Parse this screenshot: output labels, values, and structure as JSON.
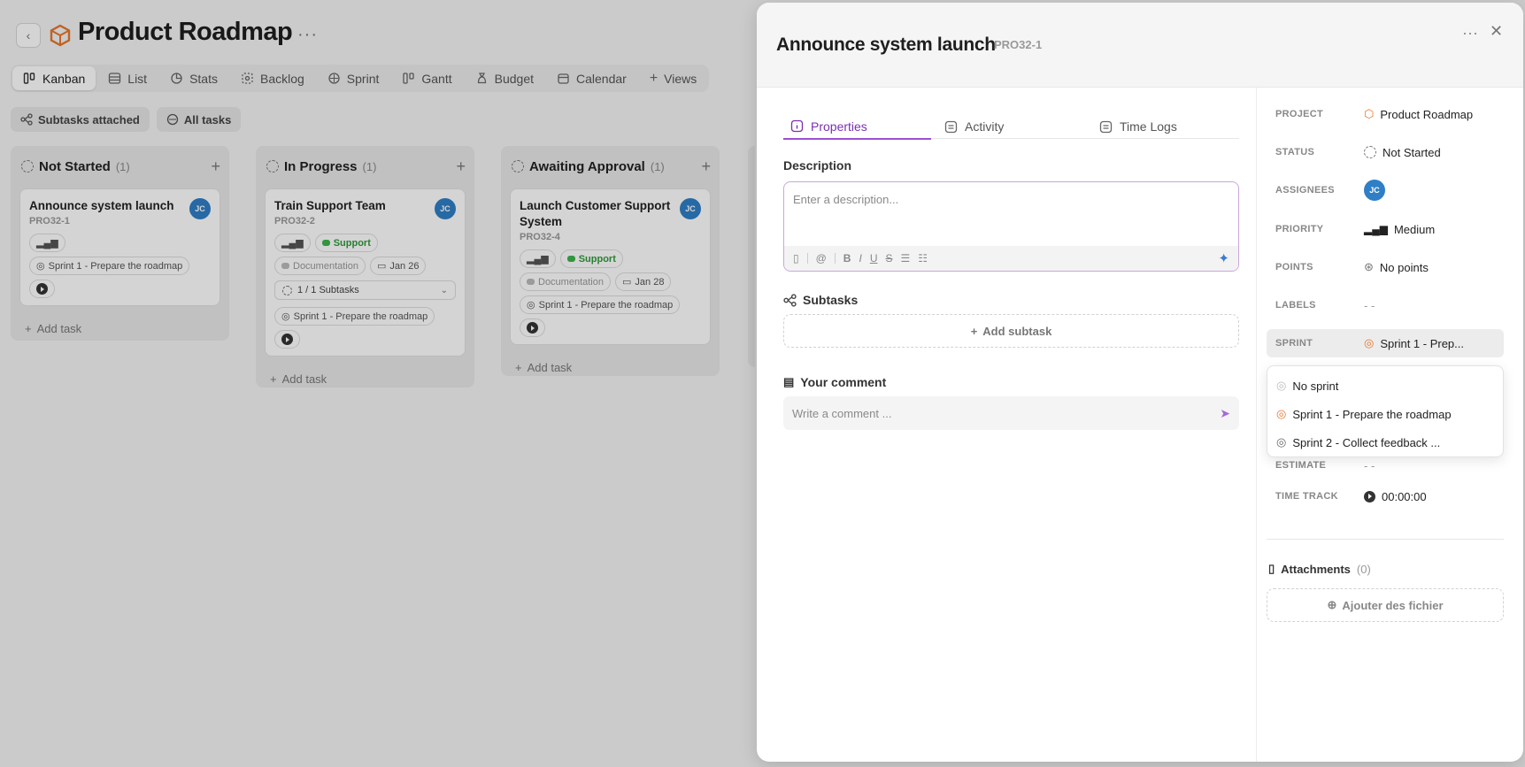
{
  "project": {
    "title": "Product Roadmap",
    "tabs": [
      "Kanban",
      "List",
      "Stats",
      "Backlog",
      "Sprint",
      "Gantt",
      "Budget",
      "Calendar",
      "Views"
    ],
    "filters": [
      "Subtasks attached",
      "All tasks"
    ]
  },
  "columns": [
    {
      "name": "Not Started",
      "count": "(1)",
      "cards": [
        {
          "title": "Announce system launch",
          "id": "PRO32-1",
          "avatar": "JC",
          "sprint": "Sprint 1 - Prepare the roadmap"
        }
      ],
      "add_label": "Add task"
    },
    {
      "name": "In Progress",
      "count": "(1)",
      "cards": [
        {
          "title": "Train Support Team",
          "id": "PRO32-2",
          "avatar": "JC",
          "label1": "Support",
          "label2": "Documentation",
          "date": "Jan 26",
          "subtasks": "1 / 1 Subtasks",
          "sprint": "Sprint 1 - Prepare the roadmap"
        }
      ],
      "add_label": "Add task"
    },
    {
      "name": "Awaiting Approval",
      "count": "(1)",
      "cards": [
        {
          "title": "Launch Customer Support System",
          "id": "PRO32-4",
          "avatar": "JC",
          "label1": "Support",
          "label2": "Documentation",
          "date": "Jan 28",
          "sprint": "Sprint 1 - Prepare the roadmap"
        }
      ],
      "add_label": "Add task"
    }
  ],
  "panel": {
    "title": "Announce system launch",
    "id": "PRO32-1",
    "tabs": [
      "Properties",
      "Activity",
      "Time Logs"
    ],
    "description_label": "Description",
    "description_placeholder": "Enter a description...",
    "subtasks_label": "Subtasks",
    "add_subtask": "Add subtask",
    "comment_label": "Your comment",
    "comment_placeholder": "Write a comment ...",
    "props": {
      "project_k": "PROJECT",
      "project_v": "Product Roadmap",
      "status_k": "STATUS",
      "status_v": "Not Started",
      "assignees_k": "ASSIGNEES",
      "assignee_avatar": "JC",
      "priority_k": "PRIORITY",
      "priority_v": "Medium",
      "points_k": "POINTS",
      "points_v": "No points",
      "labels_k": "LABELS",
      "labels_v": "- -",
      "sprint_k": "SPRINT",
      "sprint_v": "Sprint 1 - Prep...",
      "estimate_k": "ESTIMATE",
      "estimate_v": "- -",
      "timetrack_k": "TIME TRACK",
      "timetrack_v": "00:00:00"
    },
    "sprint_options": [
      "No sprint",
      "Sprint 1 - Prepare the roadmap",
      "Sprint 2 - Collect feedback ..."
    ],
    "attachments_label": "Attachments",
    "attachments_count": "(0)",
    "attach_button": "Ajouter des fichier"
  },
  "colors": {
    "accent": "#9b4fd1",
    "avatar": "#2e7fc6",
    "support": "#3bb54a",
    "sprint_icon": "#e8762b"
  }
}
